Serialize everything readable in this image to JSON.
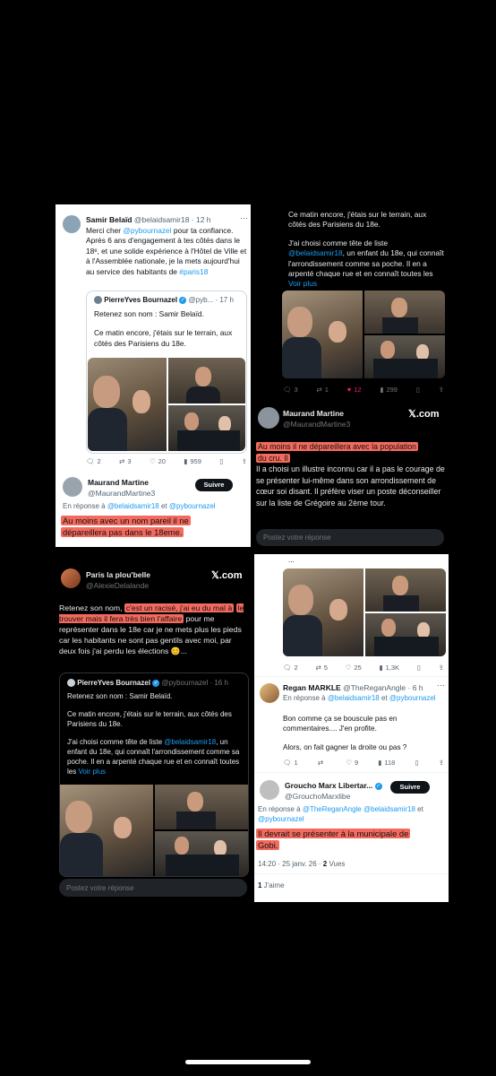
{
  "p1": {
    "author": "Samir Belaïd",
    "handle": "@belaidsamir18 · 12 h",
    "text_1": "Merci cher ",
    "text_mention": "@pybournazel",
    "text_2": " pour ta confiance.",
    "text_3": "Après 6 ans d'engagement à tes côtés dans le 18ᵉ, et une solide expérience à l'Hôtel de Ville et à l'Assemblée nationale, je la mets aujourd'hui au service des habitants de",
    "hashtag": "#paris18",
    "quote_author": "PierreYves Bournazel",
    "quote_handle": "@pyb... · 17 h",
    "quote_text_1": "Retenez son nom : Samir Belaïd.",
    "quote_text_2": "Ce matin encore, j'étais sur le terrain, aux côtés des Parisiens du 18e.",
    "act_reply": "2",
    "act_rt": "3",
    "act_like": "20",
    "act_views": "959",
    "reply_author": "Maurand Martine",
    "reply_handle": "@MaurandMartine3",
    "follow_label": "Suivre",
    "reply_to_prefix": "En réponse à ",
    "reply_to_1": "@belaidsamir18",
    "reply_to_and": " et ",
    "reply_to_2": "@pybournazel",
    "highlight_1": "Au moins avec un nom pareil il ne",
    "highlight_2": "dépareillera pas dans le 18eme."
  },
  "p2": {
    "text_1": "Ce matin encore, j'étais sur le terrain, aux côtés des Parisiens du 18e.",
    "text_2a": "J'ai choisi comme tête de liste",
    "text_mention": "@belaidsamir18",
    "text_2b": ", un enfant du 18e, qui connaît l'arrondissement comme sa poche. Il en a arpenté chaque rue et en connaît toutes les",
    "voir_plus": "Voir plus",
    "act_reply": "3",
    "act_rt": "1",
    "act_like": "12",
    "act_views": "299",
    "reply_author": "Maurand Martine",
    "reply_handle": "@MaurandMartine3",
    "brand": "𝕏.com",
    "highlight_1": "Au moins il ne dépareillera avec la population",
    "highlight_2": "du cru. Il",
    "body": "Il a choisi un illustre inconnu car il a pas le courage de se présenter lui-même dans son arrondissement de cœur soi disant. Il préfère viser un poste déconseiller sur la liste de Grégoire au 2ème tour.",
    "reply_placeholder": "Postez votre réponse"
  },
  "p3": {
    "author": "Paris la plou'belle",
    "handle": "@AlexieDelalande",
    "brand": "𝕏.com",
    "text_1": "Retenez son nom, ",
    "highlight_1": "c'est un racisé, j'ai eu du mal à",
    "highlight_2": "le trouver mais il fera très bien l'affaire",
    "text_2": " pour me représenter dans le 18e car je ne mets plus les pieds car les habitants ne sont pas gentils avec moi, par deux fois j'ai perdu les élections 😊...",
    "quote_author": "PierreYves Bournazel",
    "quote_handle": "@pybournazel · 16 h",
    "quote_text_1": "Retenez son nom : Samir Belaïd.",
    "quote_text_2": "Ce matin encore, j'étais sur le terrain, aux côtés des Parisiens du 18e.",
    "quote_text_3a": "J'ai choisi comme tête de liste ",
    "quote_mention": "@belaidsamir18",
    "quote_text_3b": ", un enfant du 18e, qui connaît l'arrondissement comme sa poche. Il en a arpenté chaque rue et en connaît toutes les ",
    "voir_plus": "Voir plus",
    "reply_placeholder": "Postez votre réponse"
  },
  "p4": {
    "ellipsis": "...",
    "act_reply": "2",
    "act_rt": "5",
    "act_like": "25",
    "act_views": "1,3K",
    "r1_author": "Regan MARKLE",
    "r1_handle": "@TheReganAngle · 6 h",
    "reply_to_prefix": "En réponse à ",
    "r1_to_1": "@belaidsamir18",
    "r1_to_and": " et ",
    "r1_to_2": "@pybournazel",
    "r1_text_1": "Bon comme ça se bouscule pas en commentaires.... J'en profite.",
    "r1_text_2": "Alors, on fait gagner la droite ou pas ?",
    "r1_reply": "1",
    "r1_rt": "",
    "r1_like": "9",
    "r1_views": "118",
    "r2_author": "Groucho Marx Libertar...",
    "r2_handle": "@GrouchoMarxlibe",
    "follow_label": "Suivre",
    "r2_to_1": "@TheReganAngle",
    "r2_to_2": "@belaidsamir18",
    "r2_to_and": " et ",
    "r2_to_3": "@pybournazel",
    "highlight_1": "Il devrait se présenter à la municipale de",
    "highlight_2": "Gobi.",
    "timestamp": "14:20 · 25 janv. 26 · ",
    "views_count": "2",
    "views_label": " Vues",
    "likes_count": "1",
    "likes_label": " J'aime"
  }
}
